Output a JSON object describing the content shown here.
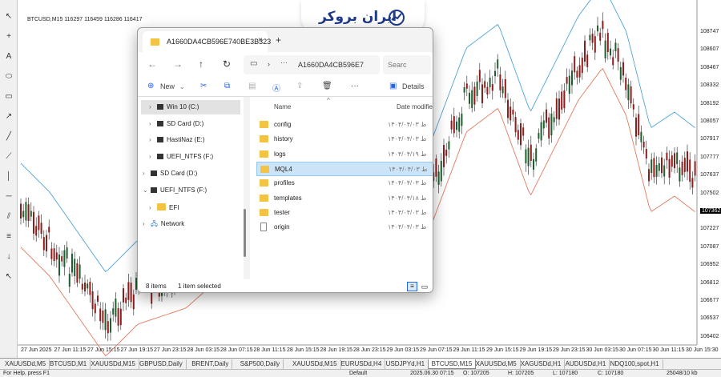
{
  "chart": {
    "title": "BTCUSD,M15  116297 116459 116286 116417",
    "price_labels": [
      "108747",
      "108607",
      "108467",
      "108332",
      "108192",
      "108057",
      "107917",
      "107777",
      "107637",
      "107502",
      "107362",
      "107227",
      "107087",
      "106952",
      "106812",
      "106677",
      "106537",
      "106402"
    ],
    "highlight_price": "107362",
    "time_labels": [
      "27 Jun 2025",
      "27 Jun 11:15",
      "27 Jun 15:15",
      "27 Jun 19:15",
      "27 Jun 23:15",
      "28 Jun 03:15",
      "28 Jun 07:15",
      "28 Jun 11:15",
      "28 Jun 15:15",
      "28 Jun 19:15",
      "28 Jun 23:15",
      "29 Jun 03:15",
      "29 Jun 07:15",
      "29 Jun 11:15",
      "29 Jun 15:15",
      "29 Jun 19:15",
      "29 Jun 23:15",
      "30 Jun 03:15",
      "30 Jun 07:15",
      "30 Jun 11:15",
      "30 Jun 15:30"
    ],
    "colors": {
      "bull": "#1f5e2e",
      "bear": "#8b1d1d",
      "envelope_top": "#4da3d8",
      "envelope_bottom": "#e07a5f"
    }
  },
  "toolbar_icons": [
    "cursor-icon",
    "crosshair-icon",
    "text-icon",
    "ellipse-icon",
    "rectangle-icon",
    "arrow-icon",
    "line-icon",
    "trendline-icon",
    "vertical-line-icon",
    "horizontal-line-icon",
    "channel-icon",
    "fibonacci-icon",
    "arrow-down-icon",
    "pointer-icon"
  ],
  "tabs": [
    "XAUUSDd,M5",
    "BTCUSD,M1",
    "XAUUSDd,M15",
    "GBPUSD,Daily",
    "BRENT,Daily",
    "S&P500,Daily",
    "XAUUSDd,M15",
    "EURUSDd,H4",
    "USDJPYd,H1",
    "BTCUSD,M15",
    "XAUUSDd,M5",
    "XAGUSDd,H1",
    "AUDUSDd,H1",
    "NDQ100,spot,H1"
  ],
  "active_tab": "BTCUSD,M15",
  "status": {
    "help": "For Help, press F1",
    "profile": "Default",
    "datetime": "2025.06.30 07:15",
    "open": "O: 107205",
    "high": "H: 107205",
    "low": "L: 107180",
    "close": "C: 107180",
    "traffic": "25048/10 kb"
  },
  "logo": {
    "text": "ایران بروکر"
  },
  "explorer": {
    "tab_title": "A1660DA4CB596E740BE3B323",
    "close_glyph": "×",
    "plus_glyph": "+",
    "address": "A1660DA4CB596E7",
    "search_placeholder": "Searc",
    "cmd_new": "New",
    "cmd_details": "Details",
    "nav_items": [
      {
        "label": "Win 10 (C:)",
        "selected": true
      },
      {
        "label": "SD Card (D:)",
        "selected": false
      },
      {
        "label": "HastiNaz (E:)",
        "selected": false
      },
      {
        "label": "UEFI_NTFS (F:)",
        "selected": false
      },
      {
        "label": "SD Card (D:)",
        "selected": false
      },
      {
        "label": "UEFI_NTFS (F:)",
        "selected": false
      },
      {
        "label": "EFI",
        "selected": false
      },
      {
        "label": "Network",
        "selected": false
      }
    ],
    "col_name": "Name",
    "col_date": "Date modifie",
    "files": [
      {
        "name": "config",
        "date": "۱۴۰۴/۰۴/۰۳ ط",
        "type": "folder"
      },
      {
        "name": "history",
        "date": "۱۴۰۴/۰۴/۰۳ ط",
        "type": "folder"
      },
      {
        "name": "logs",
        "date": "۱۴۰۴/۰۴/۱۹ ط",
        "type": "folder"
      },
      {
        "name": "MQL4",
        "date": "۱۴۰۴/۰۴/۰۳ ط",
        "type": "folder",
        "selected": true
      },
      {
        "name": "profiles",
        "date": "۱۴۰۴/۰۴/۰۳ ط",
        "type": "folder"
      },
      {
        "name": "templates",
        "date": "۱۴۰۴/۰۴/۱۸ ط",
        "type": "folder"
      },
      {
        "name": "tester",
        "date": "۱۴۰۴/۰۴/۰۳ ط",
        "type": "folder"
      },
      {
        "name": "origin",
        "date": "۱۴۰۴/۰۴/۰۳ ط",
        "type": "file"
      }
    ],
    "status_items": "8 items",
    "status_selected": "1 item selected"
  }
}
